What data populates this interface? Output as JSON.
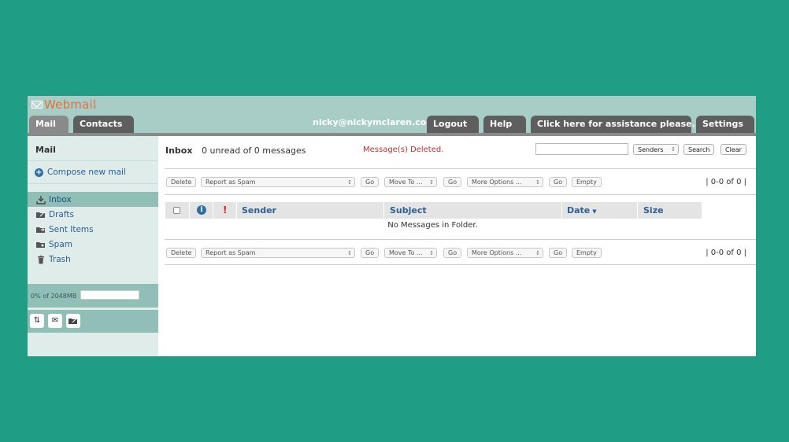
{
  "app": {
    "logo_text": "Webmail"
  },
  "tabs": {
    "mail": "Mail",
    "contacts": "Contacts"
  },
  "header": {
    "user_email": "nicky@nickymclaren.com",
    "logout": "Logout",
    "help": "Help",
    "assistance": "Click here for assistance please.",
    "settings": "Settings"
  },
  "sidebar": {
    "title": "Mail",
    "compose": "Compose new mail",
    "folders": [
      {
        "label": "Inbox",
        "icon": "inbox-icon"
      },
      {
        "label": "Drafts",
        "icon": "drafts-folder-icon"
      },
      {
        "label": "Sent Items",
        "icon": "sent-folder-icon"
      },
      {
        "label": "Spam",
        "icon": "spam-folder-icon"
      },
      {
        "label": "Trash",
        "icon": "trash-icon"
      }
    ],
    "quota_text": "0% of 2048MB",
    "quota_percent": 0
  },
  "main": {
    "title": "Inbox",
    "unread_text": "0 unread of 0 messages",
    "status_message": "Message(s) Deleted.",
    "search": {
      "value": "",
      "scope": "Senders",
      "search_label": "Search",
      "clear_label": "Clear"
    },
    "toolbar": {
      "delete": "Delete",
      "report_spam": "Report as Spam",
      "go": "Go",
      "move_to": "Move To ...",
      "more_options": "More Options ...",
      "empty": "Empty",
      "pager": "| 0-0 of 0 |"
    },
    "columns": {
      "sender": "Sender",
      "subject": "Subject",
      "date": "Date",
      "size": "Size"
    },
    "empty_message": "No Messages in Folder."
  },
  "colors": {
    "background": "#1f9e85",
    "header": "#a8cdc6",
    "tab": "#5e5e5e",
    "sidebar": "#dfecea",
    "sidebar_active": "#8fbfb7",
    "logo": "#e8703a",
    "status_red": "#c03030",
    "link_blue": "#2c5f94"
  }
}
